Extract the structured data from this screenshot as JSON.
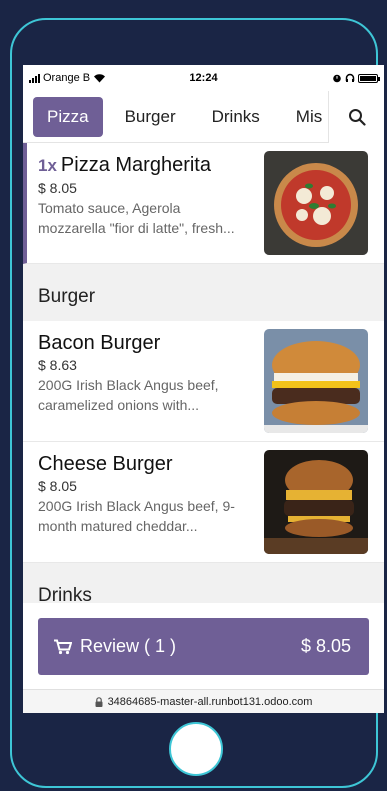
{
  "status_bar": {
    "carrier": "Orange B",
    "time": "12:24"
  },
  "tabs": [
    {
      "label": "Pizza",
      "active": true
    },
    {
      "label": "Burger",
      "active": false
    },
    {
      "label": "Drinks",
      "active": false
    },
    {
      "label": "Mis",
      "active": false
    }
  ],
  "search_icon": "search-icon",
  "products": [
    {
      "quantity": "1x",
      "name": "Pizza Margherita",
      "price": "$ 8.05",
      "description_line1": "Tomato sauce, Agerola",
      "description_line2": "mozzarella \"fior di latte\", fresh..."
    },
    {
      "name": "Bacon Burger",
      "price": "$ 8.63",
      "description_line1": "200G Irish Black Angus beef,",
      "description_line2": "caramelized onions with..."
    },
    {
      "name": "Cheese Burger",
      "price": "$ 8.05",
      "description_line1": "200G Irish Black Angus beef, 9-",
      "description_line2": "month matured cheddar..."
    }
  ],
  "sections": {
    "burger": "Burger",
    "drinks": "Drinks"
  },
  "review": {
    "label": "Review ( 1 )",
    "total": "$ 8.05",
    "icon": "cart-icon"
  },
  "url": "34864685-master-all.runbot131.odoo.com",
  "colors": {
    "accent": "#6f5f96",
    "background": "#1a2545",
    "frame": "#3ec6d6"
  }
}
